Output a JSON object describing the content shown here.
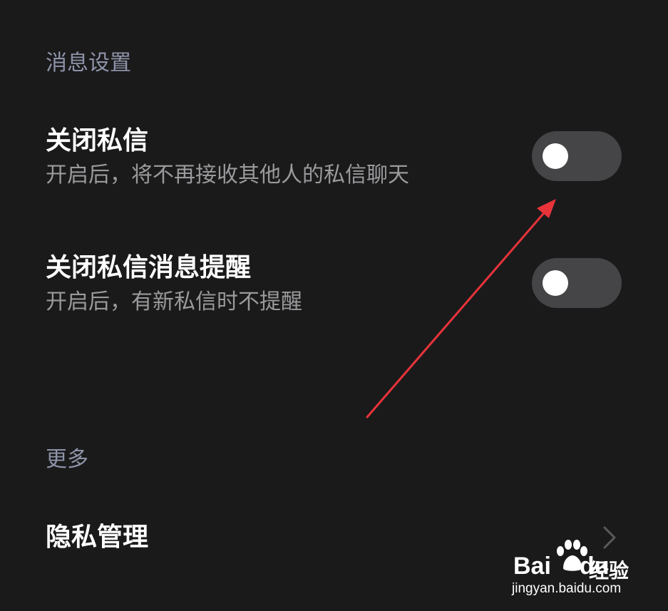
{
  "sections": {
    "message_settings": {
      "header": "消息设置",
      "items": [
        {
          "title": "关闭私信",
          "description": "开启后，将不再接收其他人的私信聊天",
          "toggle_on": false
        },
        {
          "title": "关闭私信消息提醒",
          "description": "开启后，有新私信时不提醒",
          "toggle_on": false
        }
      ]
    },
    "more": {
      "header": "更多",
      "items": [
        {
          "title": "隐私管理",
          "icon": "chevron-right-icon"
        }
      ]
    }
  },
  "annotation": {
    "type": "red-arrow",
    "color": "#e8333a"
  },
  "watermark": {
    "brand": "Bai",
    "brand_suffix": "du",
    "product": "经验",
    "url": "jingyan.baidu.com"
  },
  "colors": {
    "background": "#1a1a1b",
    "section_header": "#8e93a8",
    "toggle_track_off": "#454547",
    "toggle_knob": "#ffffff"
  }
}
